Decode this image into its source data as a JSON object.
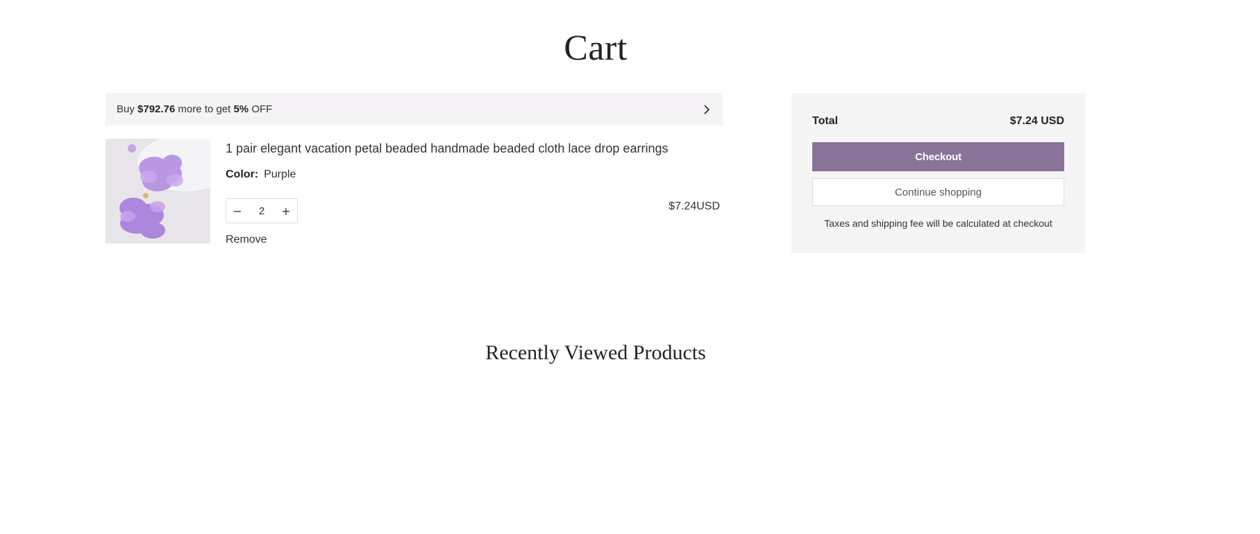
{
  "page": {
    "title": "Cart"
  },
  "promo": {
    "prefix": "Buy ",
    "amount": "$792.76",
    "middle": " more to get ",
    "discount": "5%",
    "suffix": " OFF",
    "icon": "chevron-right-icon"
  },
  "cart_item": {
    "title": "1 pair elegant vacation petal beaded handmade beaded cloth lace drop earrings",
    "variant_label": "Color:",
    "variant_value": "Purple",
    "quantity": "2",
    "decrease_symbol": "−",
    "increase_symbol": "+",
    "price": "$7.24USD",
    "remove_label": "Remove",
    "image_alt": "purple petal earrings"
  },
  "summary": {
    "total_label": "Total",
    "total_value": "$7.24 USD",
    "checkout_label": "Checkout",
    "continue_label": "Continue shopping",
    "tax_note": "Taxes and shipping fee will be calculated at checkout"
  },
  "recent": {
    "title": "Recently Viewed Products"
  },
  "colors": {
    "accent": "#8a7398",
    "promo_bg": "#f5f3f5",
    "summary_bg": "#f6f5f6"
  }
}
